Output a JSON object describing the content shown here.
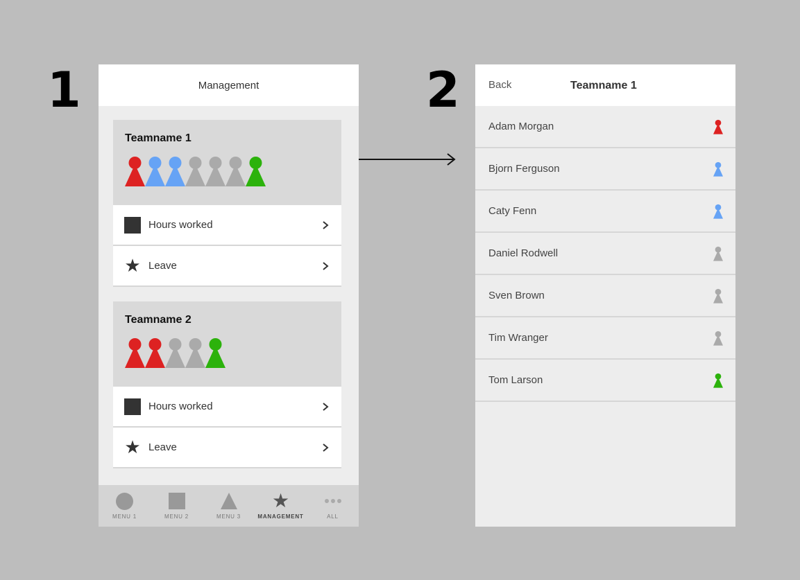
{
  "steps": [
    "1",
    "2"
  ],
  "colors": {
    "red": "#dd2222",
    "blue": "#66a3f5",
    "gray": "#aaaaaa",
    "green": "#2cb20c"
  },
  "screen1": {
    "header_title": "Management",
    "teams": [
      {
        "name": "Teamname 1",
        "pawns": [
          "red",
          "blue",
          "blue",
          "gray",
          "gray",
          "gray",
          "green"
        ],
        "rows": [
          {
            "icon": "square-icon",
            "label": "Hours worked"
          },
          {
            "icon": "star-icon",
            "label": "Leave"
          }
        ]
      },
      {
        "name": "Teamname 2",
        "pawns": [
          "red",
          "red",
          "gray",
          "gray",
          "green"
        ],
        "rows": [
          {
            "icon": "square-icon",
            "label": "Hours worked"
          },
          {
            "icon": "star-icon",
            "label": "Leave"
          }
        ]
      }
    ],
    "tabbar": [
      {
        "icon": "circle-icon",
        "label": "MENU 1",
        "active": false
      },
      {
        "icon": "square-icon",
        "label": "MENU 2",
        "active": false
      },
      {
        "icon": "triangle-icon",
        "label": "MENU 3",
        "active": false
      },
      {
        "icon": "star-icon",
        "label": "MANAGEMENT",
        "active": true
      },
      {
        "icon": "more-dots-icon",
        "label": "ALL",
        "active": false
      }
    ]
  },
  "screen2": {
    "back_label": "Back",
    "title": "Teamname 1",
    "members": [
      {
        "name": "Adam Morgan",
        "status": "red"
      },
      {
        "name": "Bjorn Ferguson",
        "status": "blue"
      },
      {
        "name": "Caty Fenn",
        "status": "blue"
      },
      {
        "name": "Daniel Rodwell",
        "status": "gray"
      },
      {
        "name": "Sven Brown",
        "status": "gray"
      },
      {
        "name": "Tim Wranger",
        "status": "gray"
      },
      {
        "name": "Tom Larson",
        "status": "green"
      }
    ]
  }
}
